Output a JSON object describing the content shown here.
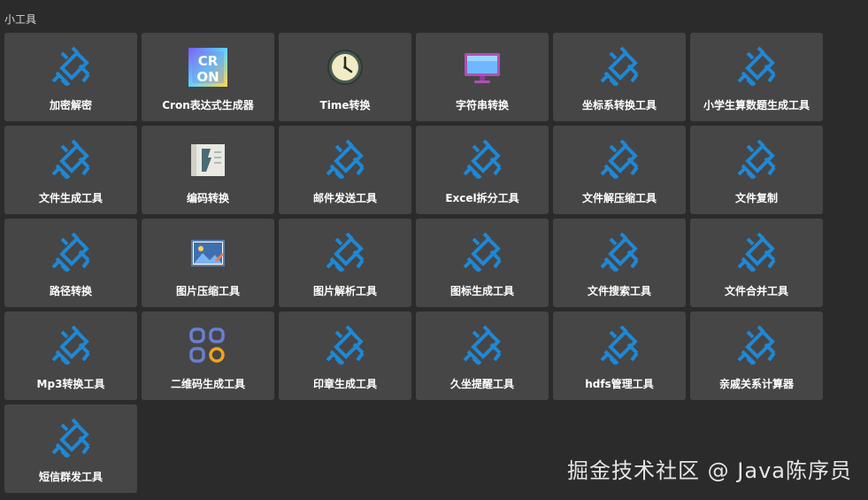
{
  "section": {
    "title": "小工具"
  },
  "colors": {
    "background": "#2b2b2b",
    "tile": "#464646",
    "plug_blue": "#1e88d6",
    "label": "#ffffff"
  },
  "tools": [
    {
      "label": "加密解密",
      "icon": "plug-icon"
    },
    {
      "label": "Cron表达式生成器",
      "icon": "cron-icon",
      "icon_text": [
        "CR",
        "ON"
      ]
    },
    {
      "label": "Time转换",
      "icon": "clock-icon"
    },
    {
      "label": "字符串转换",
      "icon": "monitor-icon"
    },
    {
      "label": "坐标系转换工具",
      "icon": "plug-icon"
    },
    {
      "label": "小学生算数题生成工具",
      "icon": "plug-icon"
    },
    {
      "label": "文件生成工具",
      "icon": "plug-icon"
    },
    {
      "label": "编码转换",
      "icon": "document-icon"
    },
    {
      "label": "邮件发送工具",
      "icon": "plug-icon"
    },
    {
      "label": "Excel拆分工具",
      "icon": "plug-icon"
    },
    {
      "label": "文件解压缩工具",
      "icon": "plug-icon"
    },
    {
      "label": "文件复制",
      "icon": "plug-icon"
    },
    {
      "label": "路径转换",
      "icon": "plug-icon"
    },
    {
      "label": "图片压缩工具",
      "icon": "image-icon"
    },
    {
      "label": "图片解析工具",
      "icon": "plug-icon"
    },
    {
      "label": "图标生成工具",
      "icon": "plug-icon"
    },
    {
      "label": "文件搜索工具",
      "icon": "plug-icon"
    },
    {
      "label": "文件合并工具",
      "icon": "plug-icon"
    },
    {
      "label": "Mp3转换工具",
      "icon": "plug-icon"
    },
    {
      "label": "二维码生成工具",
      "icon": "apps-grid-icon"
    },
    {
      "label": "印章生成工具",
      "icon": "plug-icon"
    },
    {
      "label": "久坐提醒工具",
      "icon": "plug-icon"
    },
    {
      "label": "hdfs管理工具",
      "icon": "plug-icon"
    },
    {
      "label": "亲戚关系计算器",
      "icon": "plug-icon"
    },
    {
      "label": "短信群发工具",
      "icon": "plug-icon"
    }
  ],
  "watermark": {
    "text": "掘金技术社区 @ Java陈序员"
  }
}
